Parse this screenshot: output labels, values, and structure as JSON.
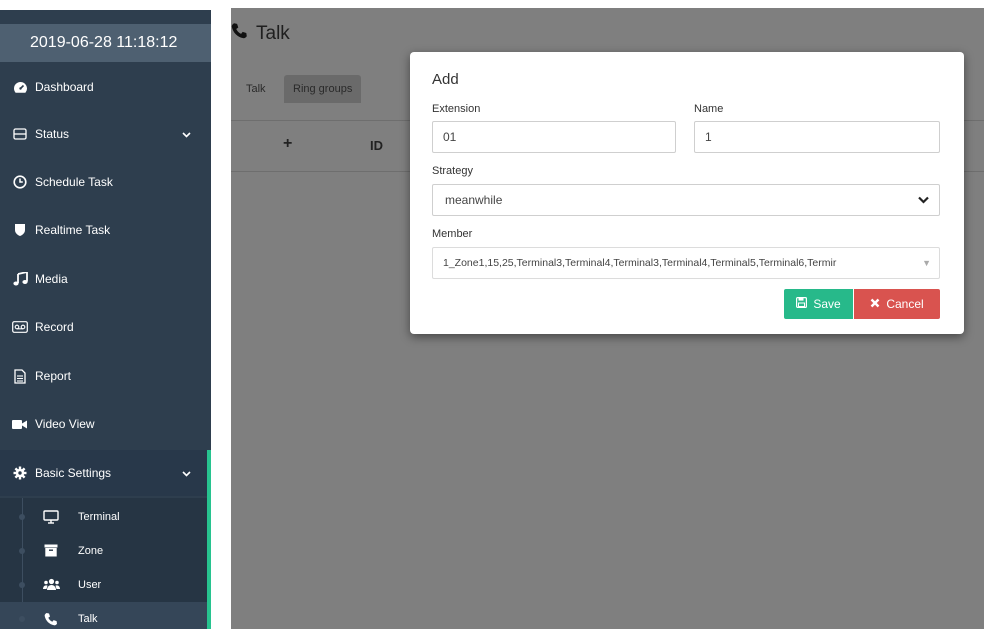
{
  "sidebar": {
    "clock": "2019-06-28 11:18:12",
    "items": [
      {
        "label": "Dashboard",
        "icon": "dashboard-icon"
      },
      {
        "label": "Status",
        "icon": "status-icon",
        "expandable": true
      },
      {
        "label": "Schedule Task",
        "icon": "clock-icon"
      },
      {
        "label": "Realtime Task",
        "icon": "shield-icon"
      },
      {
        "label": "Media",
        "icon": "music-icon"
      },
      {
        "label": "Record",
        "icon": "record-icon"
      },
      {
        "label": "Report",
        "icon": "report-icon"
      },
      {
        "label": "Video View",
        "icon": "video-icon"
      },
      {
        "label": "Basic Settings",
        "icon": "gear-icon",
        "expandable": true
      }
    ],
    "subitems": [
      {
        "label": "Terminal",
        "icon": "monitor-icon"
      },
      {
        "label": "Zone",
        "icon": "archive-icon"
      },
      {
        "label": "User",
        "icon": "users-icon"
      },
      {
        "label": "Talk",
        "icon": "phone-icon",
        "current": true
      }
    ]
  },
  "page": {
    "title": "Talk",
    "tabs": [
      "Talk",
      "Ring groups"
    ],
    "active_tab": "Ring groups",
    "table_headers": [
      "+",
      "ID"
    ]
  },
  "modal": {
    "title": "Add",
    "extension_label": "Extension",
    "extension_value": "01",
    "name_label": "Name",
    "name_value": "1",
    "strategy_label": "Strategy",
    "strategy_value": "meanwhile",
    "member_label": "Member",
    "member_value": "1_Zone1,15,25,Terminal3,Terminal4,Terminal3,Terminal4,Terminal5,Terminal6,Termir",
    "save_label": "Save",
    "cancel_label": "Cancel"
  },
  "colors": {
    "sidebar_bg": "#2e3e4e",
    "accent_green": "#27c38f",
    "save_button": "#27b98a",
    "cancel_button": "#d9534f"
  }
}
